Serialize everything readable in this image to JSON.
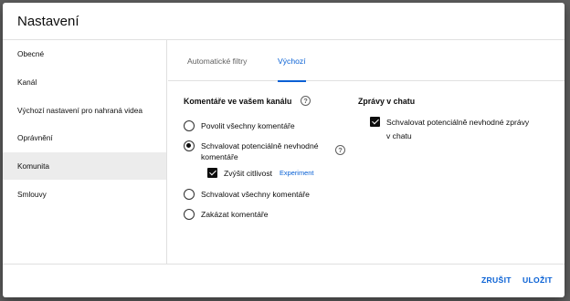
{
  "dialog": {
    "title": "Nastavení"
  },
  "sidebar": {
    "items": [
      {
        "label": "Obecné",
        "active": false
      },
      {
        "label": "Kanál",
        "active": false
      },
      {
        "label": "Výchozí nastavení pro nahraná videa",
        "active": false
      },
      {
        "label": "Oprávnění",
        "active": false
      },
      {
        "label": "Komunita",
        "active": true
      },
      {
        "label": "Smlouvy",
        "active": false
      }
    ]
  },
  "tabs": [
    {
      "label": "Automatické filtry",
      "active": false
    },
    {
      "label": "Výchozí",
      "active": true
    }
  ],
  "comments_section": {
    "title": "Komentáře ve vašem kanálu",
    "help_icon": "help-circle-icon",
    "options": [
      {
        "label": "Povolit všechny komentáře",
        "selected": false
      },
      {
        "label": "Schvalovat potenciálně nevhodné komentáře",
        "selected": true
      },
      {
        "label": "Schvalovat všechny komentáře",
        "selected": false
      },
      {
        "label": "Zakázat komentáře",
        "selected": false
      }
    ],
    "sensitivity": {
      "label": "Zvýšit citlivost",
      "checked": true,
      "badge": "Experiment"
    }
  },
  "chat_section": {
    "title": "Zprávy v chatu",
    "option": {
      "label": "Schvalovat potenciálně nevhodné zprávy v chatu",
      "checked": true
    }
  },
  "footer": {
    "cancel_label": "ZRUŠIT",
    "save_label": "ULOŽIT"
  },
  "colors": {
    "accent": "#065fd4",
    "active_item_bg": "#ececec",
    "overlay": "#5f5f5f"
  }
}
